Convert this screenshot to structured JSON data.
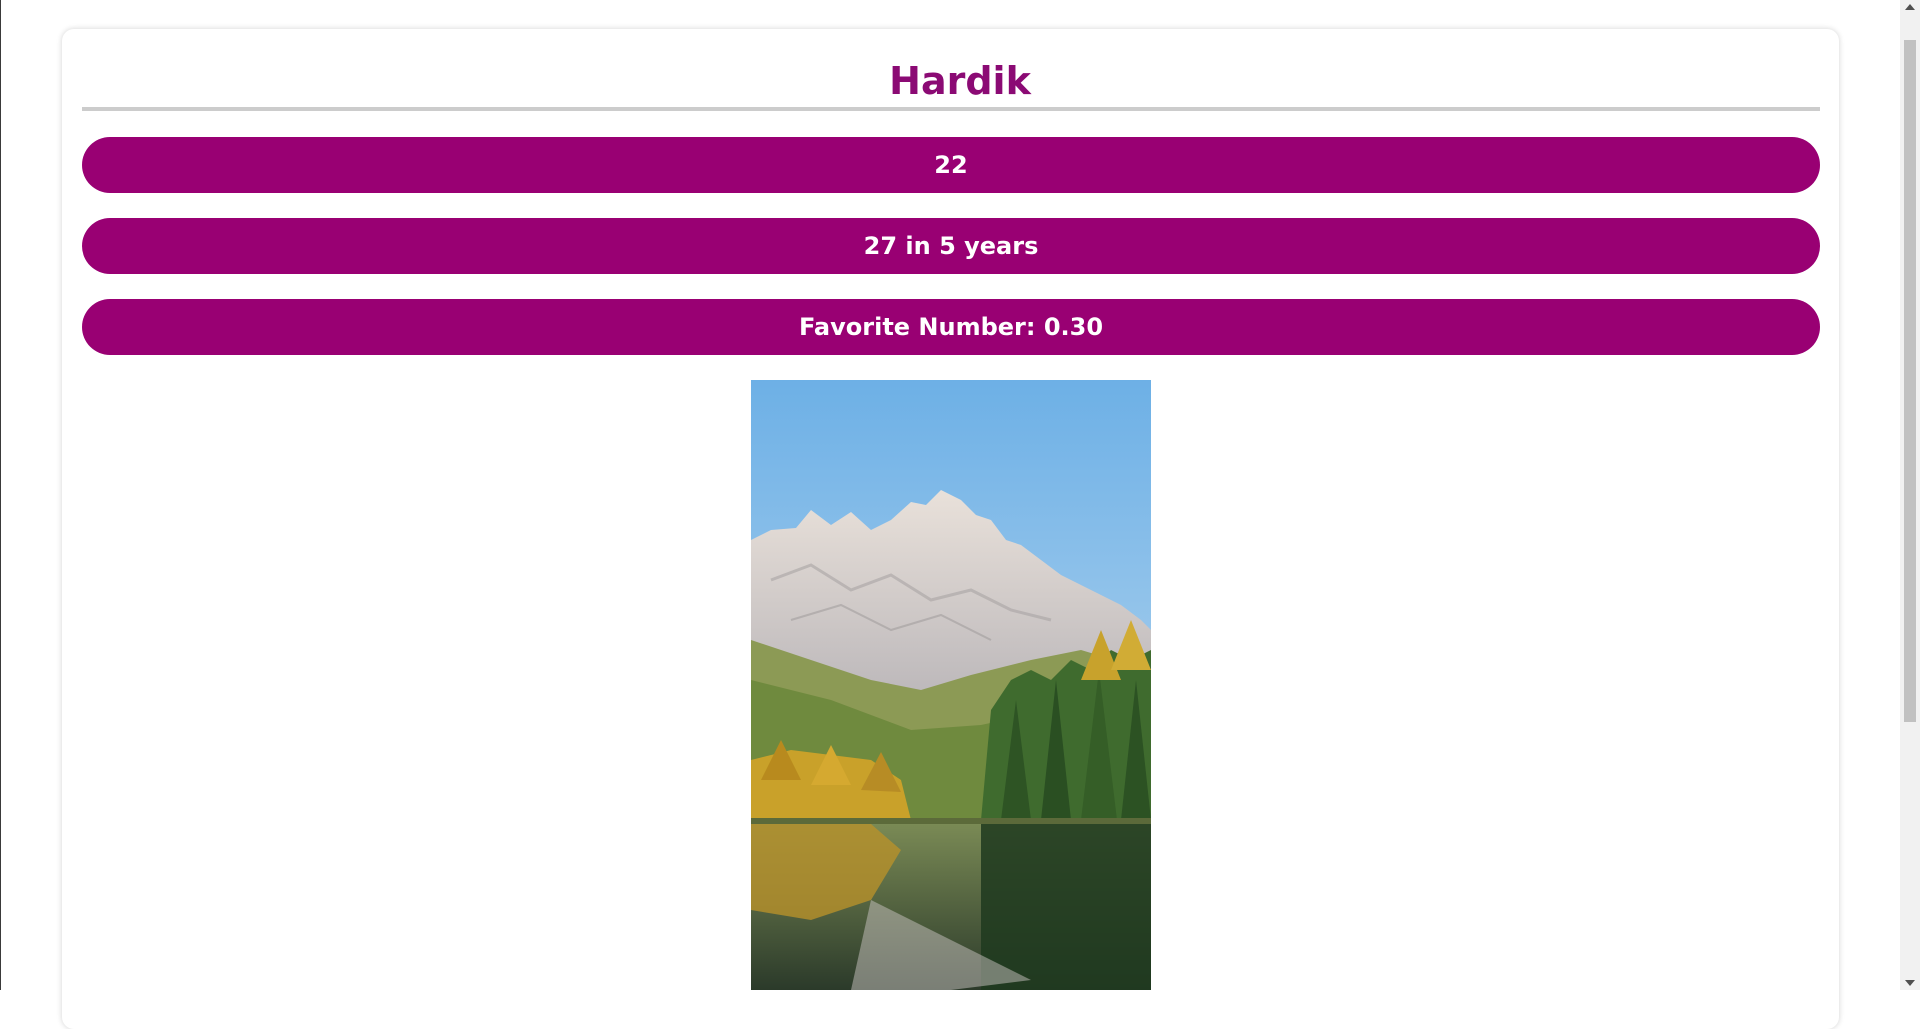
{
  "profile": {
    "name": "Hardik",
    "age": "22",
    "future_age": "27 in 5 years",
    "favorite_number": "Favorite Number: 0.30"
  },
  "photo": {
    "subject": "mountain lake landscape"
  },
  "colors": {
    "accent": "#990073",
    "title": "#8b0a74",
    "divider": "#cccccc"
  }
}
